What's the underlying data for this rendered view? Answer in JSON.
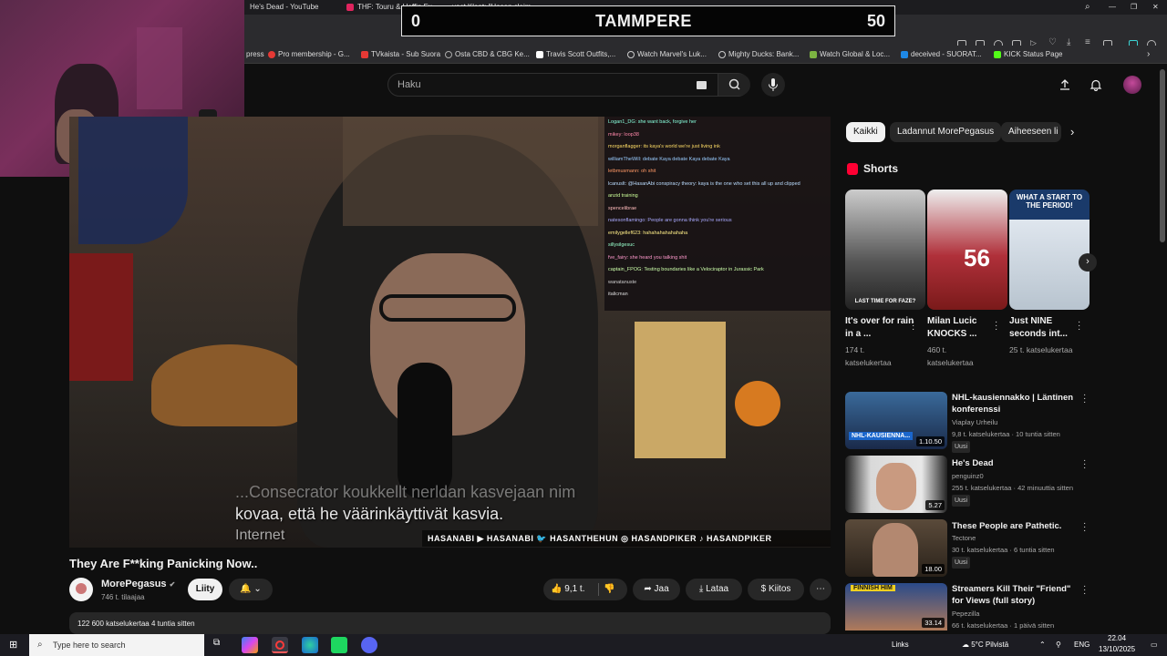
{
  "browser": {
    "tabs": [
      {
        "label": "He's Dead - YouTube"
      },
      {
        "label": "THF: Touru & Hoffin Fu..."
      },
      {
        "label": "yoct Klant: \"Hasan claim..."
      }
    ],
    "bookmarks": [
      {
        "label": "press"
      },
      {
        "label": "Pro membership - G..."
      },
      {
        "label": "TVkaista - Sub Suora"
      },
      {
        "label": "Osta CBD & CBG Ke..."
      },
      {
        "label": "Travis Scott Outfits,..."
      },
      {
        "label": "Watch Marvel's Luk..."
      },
      {
        "label": "Mighty Ducks: Bank..."
      },
      {
        "label": "Watch Global & Loc..."
      },
      {
        "label": "deceived - SUORAT..."
      },
      {
        "label": "KICK Status Page"
      }
    ]
  },
  "scoreboard": {
    "left": "0",
    "center": "TAMMPERE",
    "right": "50"
  },
  "youtube": {
    "search_placeholder": "Haku",
    "video": {
      "subtitle_line1": "...Consecrator koukkellt nerldan kasvejaan nim",
      "subtitle_line2": "kovaa, että he väärinkäyttivät kasvia.",
      "subtitle_line3": "Internet",
      "socials_banner": "HASANABI  ▶ HASANABI  🐦 HASANTHEHUN  ◎ HASANDPIKER  ♪ HASANDPIKER",
      "chat": [
        "Logan1_DG: she want back, forgive her",
        "mikey: loop38",
        "morganflagger: its kaya's world we're just living ink",
        "williamTheWill: debate Kaya debate Kaya debate Kaya",
        "letbmusmann: oh shit",
        "lcanuslt: @HasanAbi conspiracy theory: kaya is the one who set this all up and clipped",
        "anzid training",
        "spencelibrae",
        "natesonflamingo: People are gonna think you're serious",
        "emilygellef623: hahahahahahahaha",
        "sillysilgesuc",
        "fve_fairy: she heard you talking shit",
        "captain_FPOG: Testing boundaries like a Velociraptor in Jurassic Park",
        "wanatanuste",
        "italicman"
      ]
    },
    "title": "They Are F**king Panicking Now..",
    "channel": {
      "name": "MorePegasus",
      "verified": "✔",
      "subscribers": "746 t. tilaajaa"
    },
    "join_label": "Liity",
    "actions": {
      "likes": "9,1 t.",
      "share": "Jaa",
      "download": "Lataa",
      "thanks": "Kiitos"
    },
    "description_meta": "122 600 katselukertaa  4 tuntia sitten",
    "chips": [
      "Kaikki",
      "Ladannut MorePegasus",
      "Aiheeseen li"
    ],
    "shorts_heading": "Shorts",
    "shorts": [
      {
        "title": "It's over for rain in a ...",
        "views": "174 t. katselukertaa",
        "overlay": "LAST TIME FOR FAZE?"
      },
      {
        "title": "Milan Lucic KNOCKS ...",
        "views": "460 t. katselukertaa",
        "overlay": "56"
      },
      {
        "title": "Just NINE seconds int...",
        "views": "25 t. katselukertaa",
        "overlay": "WHAT A START TO THE PERIOD!"
      }
    ],
    "recommended": [
      {
        "title": "NHL-kausiennakko | Läntinen konferenssi",
        "channel": "Viaplay Urheilu",
        "meta": "9,8 t. katselukertaa · 10 tuntia sitten",
        "badge": "Uusi",
        "duration": "1.10.50",
        "thumb_text": "NHL-KAUSIENNA..."
      },
      {
        "title": "He's Dead",
        "channel": "penguinz0",
        "meta": "255 t. katselukertaa · 42 minuuttia sitten",
        "badge": "Uusi",
        "duration": "5.27",
        "thumb_text": ""
      },
      {
        "title": "These People are Pathetic.",
        "channel": "Tectone",
        "meta": "30 t. katselukertaa · 6 tuntia sitten",
        "badge": "Uusi",
        "duration": "18.00",
        "thumb_text": ""
      },
      {
        "title": "Streamers Kill Their \"Friend\" for Views (full story)",
        "channel": "Pepezilla",
        "meta": "66 t. katselukertaa · 1 päivä sitten",
        "badge": "",
        "duration": "33.14",
        "thumb_text": "FINNISH HIM"
      }
    ]
  },
  "taskbar": {
    "search_placeholder": "Type here to search",
    "links_label": "Links",
    "weather": "5°C Pilvistä",
    "language": "ENG",
    "time": "22.04",
    "date": "13/10/2025"
  },
  "colors": {
    "yt_bg": "#0f0f0f",
    "yt_red": "#ff0033",
    "chip_active": "#f1f1f1"
  }
}
